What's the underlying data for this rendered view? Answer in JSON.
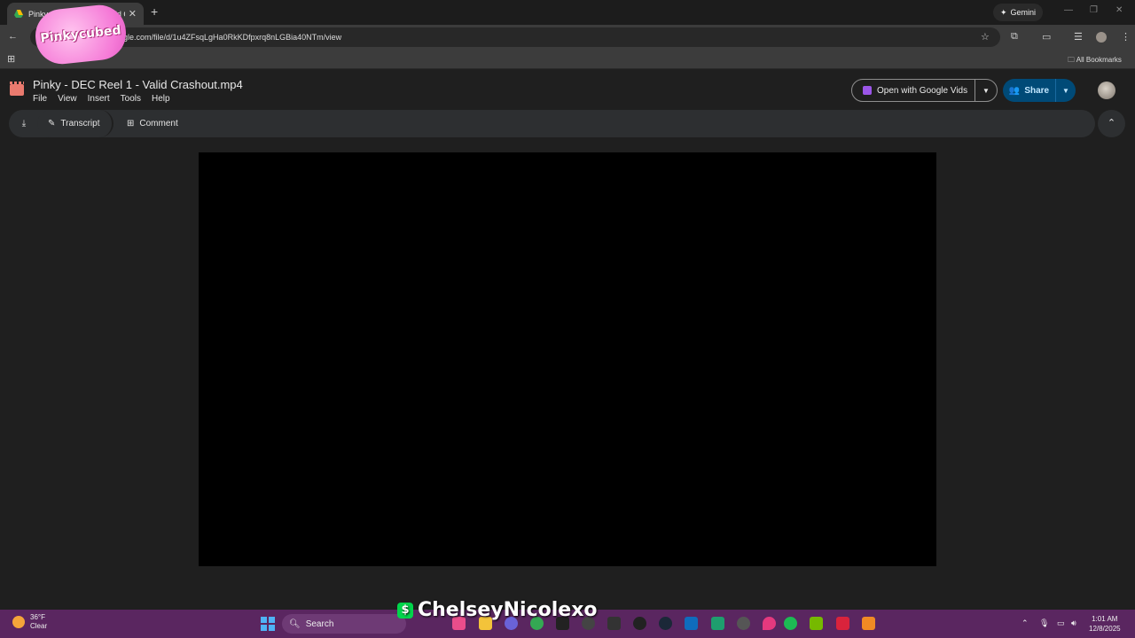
{
  "browser": {
    "tab_title": "Pinky - DEC Reel 1 - Valid Crashout.mp4",
    "url": "drive.google.com/file/d/1u4ZFsqLgHa0RkKDfpxrq8nLGBia40NTm/view",
    "url_visible": "ogle.com/file/d/1u4ZFsqLgHa0RkKDfpxrq8nLGBia40NTm/view",
    "gemini_label": "Gemini",
    "all_bookmarks": "All Bookmarks",
    "sticker_text": "Pinkycubed"
  },
  "drive": {
    "title": "Pinky - DEC Reel 1 - Valid Crashout.mp4",
    "menu": [
      "File",
      "View",
      "Insert",
      "Tools",
      "Help"
    ],
    "open_with": "Open with Google Vids",
    "share": "Share",
    "actions": {
      "transcript": "Transcript",
      "comment": "Comment"
    }
  },
  "taskbar": {
    "weather_temp": "36°F",
    "weather_desc": "Clear",
    "search_placeholder": "Search",
    "watermark": "ChelseyNicolexo",
    "time": "1:01 AM",
    "date": "12/8/2025"
  },
  "colors": {
    "accent_share": "#004a77",
    "video_bg": "#000000",
    "taskbar": "#5a2660"
  }
}
